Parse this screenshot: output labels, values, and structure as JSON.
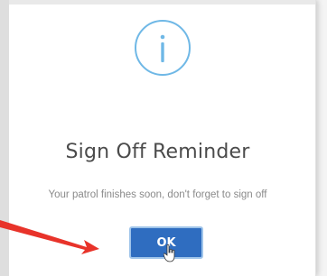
{
  "dialog": {
    "icon": "info-circle-icon",
    "title": "Sign Off Reminder",
    "message": "Your patrol finishes soon, don't forget to sign off",
    "ok_label": "OK"
  },
  "colors": {
    "accent_blue": "#2f6dc0",
    "icon_blue": "#6fb8e6",
    "arrow_red": "#e8332a"
  },
  "annotation": {
    "arrow_icon": "red-arrow-pointer"
  }
}
